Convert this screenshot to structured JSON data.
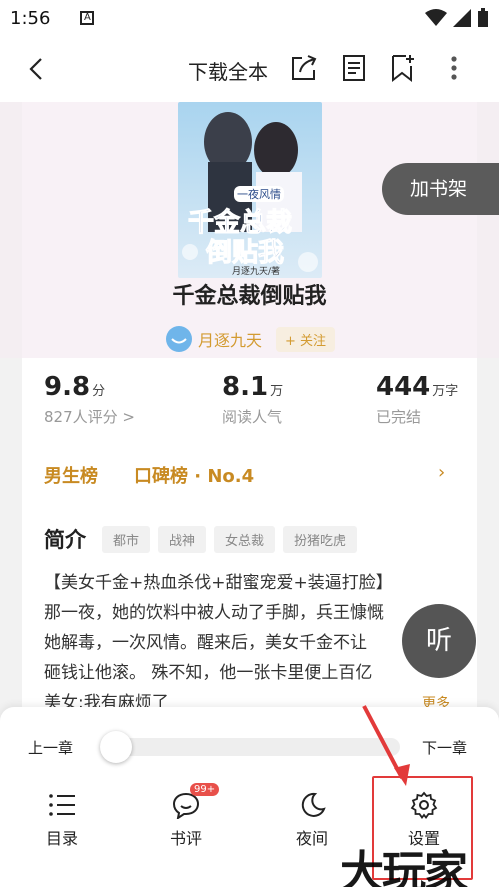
{
  "status_bar": {
    "time": "1:56",
    "notification_letter": "A"
  },
  "toolbar": {
    "download_label": "下载全本"
  },
  "book": {
    "title": "千金总裁倒贴我",
    "cover_title_line1": "千金总裁",
    "cover_title_line2": "倒贴我",
    "cover_subtitle": "一夜风情",
    "cover_author": "月逐九天/著"
  },
  "author": {
    "name": "月逐九天",
    "follow_label": "+ 关注"
  },
  "add_shelf_label": "加书架",
  "stats": {
    "rating": {
      "value": "9.8",
      "unit": "分",
      "sub": "827人评分 >"
    },
    "reads": {
      "value": "8.1",
      "unit": "万",
      "sub": "阅读人气"
    },
    "words": {
      "value": "444",
      "unit": "万字",
      "sub": "已完结"
    }
  },
  "rank": {
    "list_label": "男生榜",
    "rank_label": "口碑榜 · No.4"
  },
  "intro": {
    "heading": "简介",
    "tags": [
      "都市",
      "战神",
      "女总裁",
      "扮猪吃虎"
    ],
    "lines": [
      "【美女千金+热血杀伐+甜蜜宠爱+装逼打脸】",
      "那一夜，她的饮料中被人动了手脚，兵王慷慨",
      "她解毒，一次风情。醒来后，美女千金不让",
      "砸钱让他滚。 殊不知，他一张卡里便上百亿",
      "美女:我有麻烦了"
    ],
    "more_label": "更多"
  },
  "listen_label": "听",
  "reader_panel": {
    "prev_label": "上一章",
    "next_label": "下一章",
    "progress": 0.0,
    "nav": {
      "catalog": "目录",
      "comments": "书评",
      "comments_badge": "99+",
      "night": "夜间",
      "settings": "设置"
    }
  },
  "watermark": "大玩家",
  "colors": {
    "accent": "#d39b31",
    "highlight": "#e23a3a"
  }
}
